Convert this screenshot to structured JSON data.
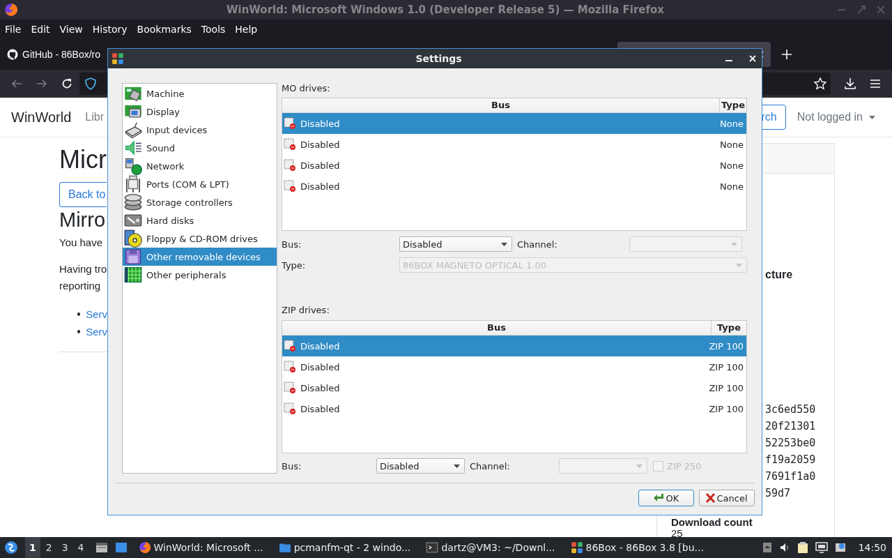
{
  "browser": {
    "title": "WinWorld: Microsoft Windows 1.0 (Developer Release 5) — Mozilla Firefox",
    "menu": [
      "File",
      "Edit",
      "View",
      "History",
      "Bookmarks",
      "Tools",
      "Help"
    ],
    "tabs": [
      {
        "label": "GitHub - 86Box/ro",
        "selected": false
      },
      {
        "selected": true
      }
    ]
  },
  "page": {
    "site_name": "WinWorld",
    "nav_link": "Libr",
    "search_button": "rch",
    "account_menu": "Not logged in",
    "heading": "Micr",
    "back_button": "Back to",
    "subheading": "Mirro",
    "paragraph": "You have",
    "paragraph_2": [
      "Having tro",
      "reporting"
    ],
    "links": [
      "Serv",
      "Serv"
    ],
    "side_card": {
      "heading": "cture",
      "hashes": [
        "3c6ed550",
        "20f21301",
        "52253be0",
        "f19a2059",
        "7691f1a0",
        "59d7"
      ],
      "download_label": "Download count",
      "download_count": "25"
    }
  },
  "dialog": {
    "title": "Settings",
    "categories": [
      {
        "label": "Machine",
        "selected": false
      },
      {
        "label": "Display",
        "selected": false
      },
      {
        "label": "Input devices",
        "selected": false
      },
      {
        "label": "Sound",
        "selected": false
      },
      {
        "label": "Network",
        "selected": false
      },
      {
        "label": "Ports (COM & LPT)",
        "selected": false
      },
      {
        "label": "Storage controllers",
        "selected": false
      },
      {
        "label": "Hard disks",
        "selected": false
      },
      {
        "label": "Floppy & CD-ROM drives",
        "selected": false
      },
      {
        "label": "Other removable devices",
        "selected": true
      },
      {
        "label": "Other peripherals",
        "selected": false
      }
    ],
    "mo": {
      "label": "MO drives:",
      "columns": [
        "Bus",
        "Type"
      ],
      "rows": [
        {
          "bus": "Disabled",
          "type": "None",
          "selected": true
        },
        {
          "bus": "Disabled",
          "type": "None",
          "selected": false
        },
        {
          "bus": "Disabled",
          "type": "None",
          "selected": false
        },
        {
          "bus": "Disabled",
          "type": "None",
          "selected": false
        }
      ],
      "bus_label": "Bus:",
      "bus_value": "Disabled",
      "channel_label": "Channel:",
      "channel_disabled": true,
      "type_label": "Type:",
      "type_value": "86BOX MAGNETO OPTICAL 1.00",
      "type_disabled": true
    },
    "zip": {
      "label": "ZIP drives:",
      "columns": [
        "Bus",
        "Type"
      ],
      "rows": [
        {
          "bus": "Disabled",
          "type": "ZIP 100",
          "selected": true
        },
        {
          "bus": "Disabled",
          "type": "ZIP 100",
          "selected": false
        },
        {
          "bus": "Disabled",
          "type": "ZIP 100",
          "selected": false
        },
        {
          "bus": "Disabled",
          "type": "ZIP 100",
          "selected": false
        }
      ],
      "bus_label": "Bus:",
      "bus_value": "Disabled",
      "channel_label": "Channel:",
      "channel_disabled": true,
      "zip250": {
        "label": "ZIP 250",
        "checked": false,
        "disabled": true
      }
    },
    "buttons": [
      {
        "label": "OK",
        "kind": "ok"
      },
      {
        "label": "Cancel",
        "kind": "cancel"
      }
    ]
  },
  "taskbar": {
    "workspaces": [
      {
        "label": "1",
        "selected": true
      },
      {
        "label": "2",
        "selected": false
      },
      {
        "label": "3",
        "selected": false
      },
      {
        "label": "4",
        "selected": false
      }
    ],
    "tasks": [
      {
        "label": "WinWorld: Microsoft ...",
        "kind": "browser"
      },
      {
        "label": "pcmanfm-qt - 2 windo...",
        "kind": "folder"
      },
      {
        "label": "dartz@VM3: ~/Downl...",
        "kind": "terminal"
      },
      {
        "label": "86Box - 86Box 3.8 [bu...",
        "kind": "emulator"
      }
    ],
    "clock": "14:50"
  }
}
